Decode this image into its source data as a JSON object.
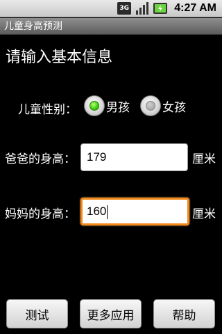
{
  "status_bar": {
    "network": "3G",
    "time": "4:27 AM"
  },
  "app_title": "儿童身高预测",
  "heading": "请输入基本信息",
  "gender": {
    "label": "儿童性别：",
    "options": [
      {
        "label": "男孩",
        "selected": true
      },
      {
        "label": "女孩",
        "selected": false
      }
    ]
  },
  "father_height": {
    "label": "爸爸的身高：",
    "value": "179",
    "unit": "厘米"
  },
  "mother_height": {
    "label": "妈妈的身高：",
    "value": "160",
    "unit": "厘米"
  },
  "buttons": {
    "test": "测试",
    "more_apps": "更多应用",
    "help": "帮助"
  },
  "colors": {
    "focus_border": "#f28a1b",
    "radio_selected": "#41d010"
  }
}
